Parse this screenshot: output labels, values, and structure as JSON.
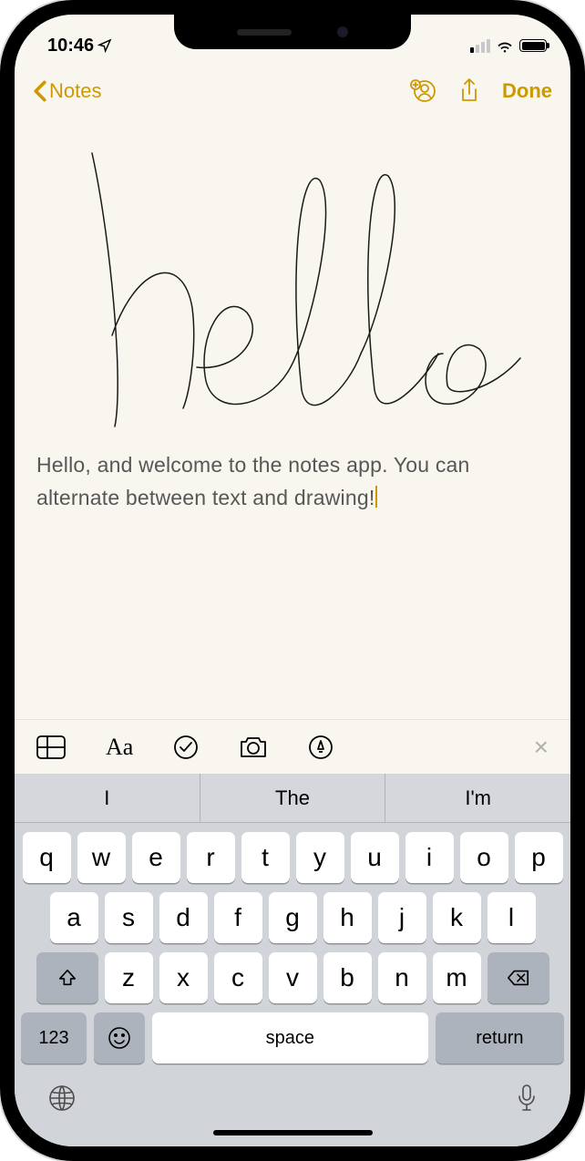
{
  "status": {
    "time": "10:46",
    "wifi": true,
    "battery_pct": 95
  },
  "nav": {
    "back_label": "Notes",
    "done_label": "Done"
  },
  "note": {
    "handwriting_text": "hello",
    "body": "Hello, and welcome to the notes app. You can alternate between text and drawing!"
  },
  "toolbar": {
    "close_label": "×"
  },
  "suggestions": [
    "I",
    "The",
    "I'm"
  ],
  "keyboard": {
    "row1": [
      "q",
      "w",
      "e",
      "r",
      "t",
      "y",
      "u",
      "i",
      "o",
      "p"
    ],
    "row2": [
      "a",
      "s",
      "d",
      "f",
      "g",
      "h",
      "j",
      "k",
      "l"
    ],
    "row3": [
      "z",
      "x",
      "c",
      "v",
      "b",
      "n",
      "m"
    ],
    "num_key": "123",
    "space_key": "space",
    "return_key": "return"
  },
  "colors": {
    "accent": "#cc9a00"
  }
}
